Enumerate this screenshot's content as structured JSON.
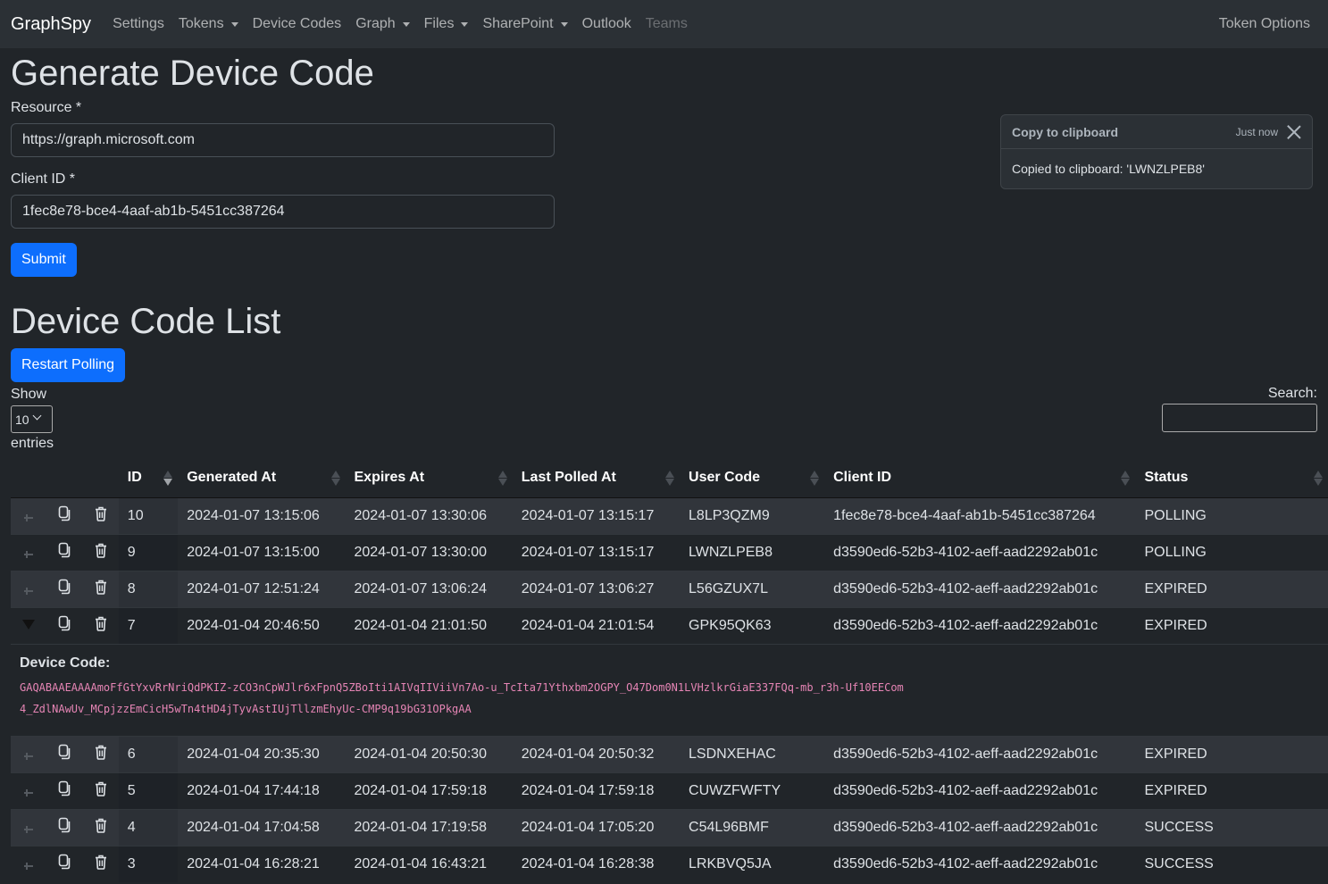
{
  "navbar": {
    "brand": "GraphSpy",
    "items": [
      {
        "label": "Settings",
        "dropdown": false,
        "disabled": false
      },
      {
        "label": "Tokens",
        "dropdown": true,
        "disabled": false
      },
      {
        "label": "Device Codes",
        "dropdown": false,
        "disabled": false
      },
      {
        "label": "Graph",
        "dropdown": true,
        "disabled": false
      },
      {
        "label": "Files",
        "dropdown": true,
        "disabled": false
      },
      {
        "label": "SharePoint",
        "dropdown": true,
        "disabled": false
      },
      {
        "label": "Outlook",
        "dropdown": false,
        "disabled": false
      },
      {
        "label": "Teams",
        "dropdown": false,
        "disabled": true
      }
    ],
    "right_label": "Token Options"
  },
  "generate": {
    "title": "Generate Device Code",
    "resource_label": "Resource *",
    "resource_value": "https://graph.microsoft.com",
    "client_id_label": "Client ID *",
    "client_id_value": "1fec8e78-bce4-4aaf-ab1b-5451cc387264",
    "submit_label": "Submit"
  },
  "toast": {
    "title": "Copy to clipboard",
    "time": "Just now",
    "message": "Copied to clipboard: 'LWNZLPEB8'"
  },
  "list": {
    "title": "Device Code List",
    "restart_label": "Restart Polling",
    "show_label": "Show",
    "entries_value": "10",
    "entries_label": "entries",
    "search_label": "Search:",
    "search_value": "",
    "columns": [
      "ID",
      "Generated At",
      "Expires At",
      "Last Polled At",
      "User Code",
      "Client ID",
      "Status"
    ],
    "sorted_column": "ID",
    "sort_direction": "desc",
    "rows": [
      {
        "id": "10",
        "generated": "2024-01-07 13:15:06",
        "expires": "2024-01-07 13:30:06",
        "polled": "2024-01-07 13:15:17",
        "user_code": "L8LP3QZM9",
        "client_id": "1fec8e78-bce4-4aaf-ab1b-5451cc387264",
        "status": "POLLING",
        "expanded": false
      },
      {
        "id": "9",
        "generated": "2024-01-07 13:15:00",
        "expires": "2024-01-07 13:30:00",
        "polled": "2024-01-07 13:15:17",
        "user_code": "LWNZLPEB8",
        "client_id": "d3590ed6-52b3-4102-aeff-aad2292ab01c",
        "status": "POLLING",
        "expanded": false
      },
      {
        "id": "8",
        "generated": "2024-01-07 12:51:24",
        "expires": "2024-01-07 13:06:24",
        "polled": "2024-01-07 13:06:27",
        "user_code": "L56GZUX7L",
        "client_id": "d3590ed6-52b3-4102-aeff-aad2292ab01c",
        "status": "EXPIRED",
        "expanded": false
      },
      {
        "id": "7",
        "generated": "2024-01-04 20:46:50",
        "expires": "2024-01-04 21:01:50",
        "polled": "2024-01-04 21:01:54",
        "user_code": "GPK95QK63",
        "client_id": "d3590ed6-52b3-4102-aeff-aad2292ab01c",
        "status": "EXPIRED",
        "expanded": true
      },
      {
        "id": "6",
        "generated": "2024-01-04 20:35:30",
        "expires": "2024-01-04 20:50:30",
        "polled": "2024-01-04 20:50:32",
        "user_code": "LSDNXEHAC",
        "client_id": "d3590ed6-52b3-4102-aeff-aad2292ab01c",
        "status": "EXPIRED",
        "expanded": false
      },
      {
        "id": "5",
        "generated": "2024-01-04 17:44:18",
        "expires": "2024-01-04 17:59:18",
        "polled": "2024-01-04 17:59:18",
        "user_code": "CUWZFWFTY",
        "client_id": "d3590ed6-52b3-4102-aeff-aad2292ab01c",
        "status": "EXPIRED",
        "expanded": false
      },
      {
        "id": "4",
        "generated": "2024-01-04 17:04:58",
        "expires": "2024-01-04 17:19:58",
        "polled": "2024-01-04 17:05:20",
        "user_code": "C54L96BMF",
        "client_id": "d3590ed6-52b3-4102-aeff-aad2292ab01c",
        "status": "SUCCESS",
        "expanded": false
      },
      {
        "id": "3",
        "generated": "2024-01-04 16:28:21",
        "expires": "2024-01-04 16:43:21",
        "polled": "2024-01-04 16:28:38",
        "user_code": "LRKBVQ5JA",
        "client_id": "d3590ed6-52b3-4102-aeff-aad2292ab01c",
        "status": "SUCCESS",
        "expanded": false
      }
    ],
    "detail": {
      "label": "Device Code:",
      "value": "GAQABAAEAAAAmoFfGtYxvRrNriQdPKIZ-zCO3nCpWJlr6xFpnQ5ZBoIti1AIVqIIViiVn7Ao-u_TcIta71Ythxbm2OGPY_O47Dom0N1LVHzlkrGiaE337FQq-mb_r3h-Uf10EECom4_ZdlNAwUv_MCpjzzEmCicH5wTn4tHD4jTyvAstIUjTllzmEhyUc-CMP9q19bG31OPkgAA"
    }
  }
}
